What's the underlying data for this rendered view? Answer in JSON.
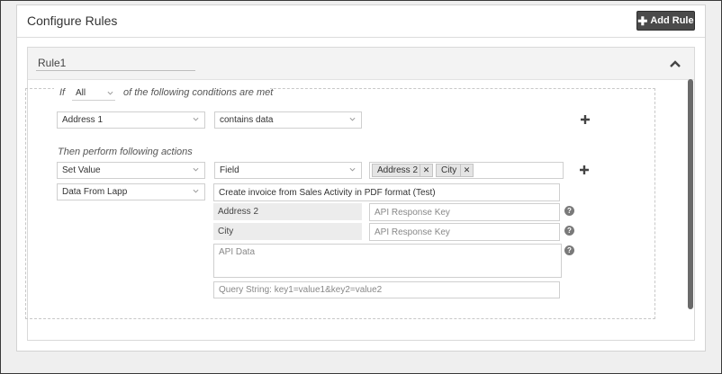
{
  "panel": {
    "title": "Configure Rules",
    "add_rule_label": "Add Rule"
  },
  "rule": {
    "name": "Rule1",
    "conditions": {
      "if_label": "If",
      "match_mode": "All",
      "suffix_label": "of the following conditions are met",
      "rows": [
        {
          "field": "Address 1",
          "operator": "contains data"
        }
      ]
    },
    "actions": {
      "heading": "Then perform following actions",
      "action_type": "Set Value",
      "target": "Field",
      "selected_fields": [
        "Address 2",
        "City"
      ],
      "source": "Data From Lapp",
      "lapp_name": "Create invoice from Sales Activity in PDF format (Test)",
      "mappings": [
        {
          "field": "Address 2",
          "key_placeholder": "API Response Key"
        },
        {
          "field": "City",
          "key_placeholder": "API Response Key"
        }
      ],
      "api_data_placeholder": "API Data",
      "query_string_placeholder": "Query String: key1=value1&key2=value2"
    }
  },
  "icons": {
    "add": "plus-icon",
    "collapse": "chevron-up-icon",
    "dropdown": "chevron-down-icon",
    "remove": "close-icon",
    "help": "question-icon"
  },
  "colors": {
    "button_bg": "#4a4a4a",
    "header_bg": "#f3f3f3",
    "help_icon": "#7a7a7a"
  }
}
